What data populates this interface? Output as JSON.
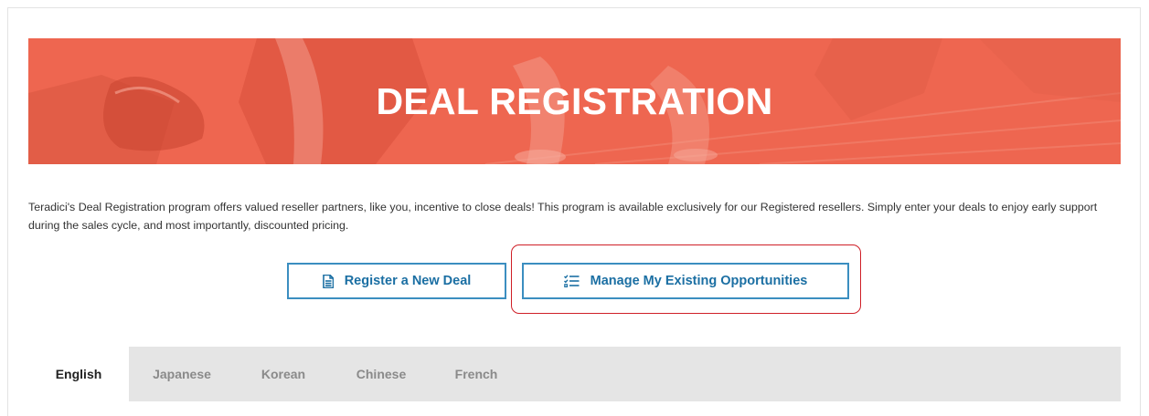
{
  "banner": {
    "title": "DEAL REGISTRATION"
  },
  "intro": {
    "text": "Teradici's Deal Registration program offers valued reseller partners, like you, incentive to close deals! This program is available exclusively for our Registered resellers. Simply enter your deals to enjoy early support during the sales cycle, and most importantly, discounted pricing."
  },
  "actions": {
    "register": {
      "label": "Register a New Deal",
      "icon": "document-icon"
    },
    "manage": {
      "label": "Manage My Existing Opportunities",
      "icon": "checklist-icon"
    }
  },
  "tabs": [
    {
      "label": "English",
      "active": true
    },
    {
      "label": "Japanese",
      "active": false
    },
    {
      "label": "Korean",
      "active": false
    },
    {
      "label": "Chinese",
      "active": false
    },
    {
      "label": "French",
      "active": false
    }
  ],
  "colors": {
    "banner": "#ee6650",
    "accent": "#1b6fa3",
    "button_border": "#3b8ec0",
    "highlight": "#cf1f27",
    "tabbar": "#e5e5e5"
  }
}
